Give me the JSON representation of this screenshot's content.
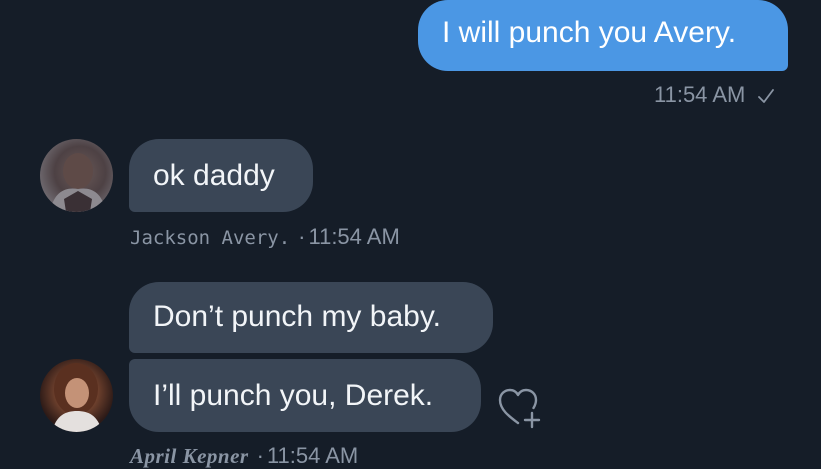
{
  "messages": {
    "sent": {
      "text": "I will punch you Avery.",
      "time": "11:54 AM"
    },
    "jackson": {
      "text": "ok daddy",
      "sender": "Jackson Avery.",
      "time": "11:54 AM"
    },
    "april": {
      "text_1": "Don’t punch my baby.",
      "text_2": "I’ll punch you, Derek.",
      "sender": "April Kepner",
      "time": "11:54 AM"
    }
  },
  "separator": "·",
  "colors": {
    "background": "#151d28",
    "sent_bubble": "#4b97e4",
    "received_bubble": "#3a4656",
    "meta_text": "#8a95a4"
  },
  "icons": {
    "read_receipt": "check-icon",
    "reaction": "heart-add-icon"
  }
}
